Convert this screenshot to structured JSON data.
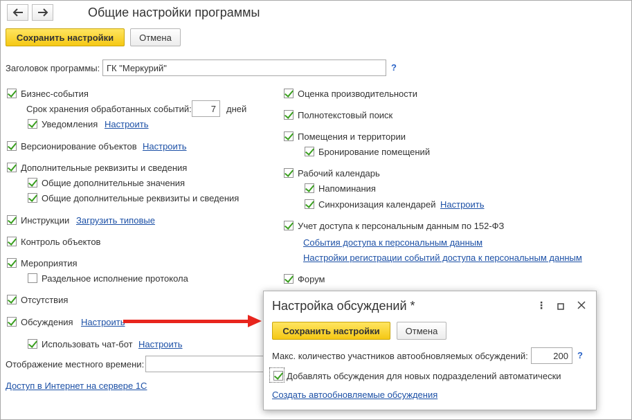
{
  "header": {
    "back_icon": "arrow-left-icon",
    "forward_icon": "arrow-right-icon",
    "title": "Общие настройки программы"
  },
  "toolbar": {
    "save_label": "Сохранить настройки",
    "cancel_label": "Отмена"
  },
  "program_title": {
    "label": "Заголовок программы:",
    "value": "ГК \"Меркурий\"",
    "help": "?"
  },
  "left": {
    "business_events": {
      "label": "Бизнес-события",
      "checked": true
    },
    "retention": {
      "label": "Срок хранения обработанных событий:",
      "value": "7",
      "unit": "дней"
    },
    "notifications": {
      "label": "Уведомления",
      "checked": true,
      "link": "Настроить"
    },
    "versioning": {
      "label": "Версионирование объектов",
      "checked": true,
      "link": "Настроить"
    },
    "extra_props": {
      "label": "Дополнительные реквизиты и сведения",
      "checked": true
    },
    "common_values": {
      "label": "Общие дополнительные значения",
      "checked": true
    },
    "common_props": {
      "label": "Общие дополнительные реквизиты и сведения",
      "checked": true
    },
    "instructions": {
      "label": "Инструкции",
      "checked": true,
      "link": "Загрузить типовые"
    },
    "object_control": {
      "label": "Контроль объектов",
      "checked": true
    },
    "events": {
      "label": "Мероприятия",
      "checked": true
    },
    "separate_protocol": {
      "label": "Раздельное исполнение протокола",
      "checked": false
    },
    "absences": {
      "label": "Отсутствия",
      "checked": true
    },
    "discussions": {
      "label": "Обсуждения",
      "checked": true,
      "link": "Настроить"
    },
    "chatbot": {
      "label": "Использовать чат-бот",
      "checked": true,
      "link": "Настроить"
    },
    "local_time": {
      "label": "Отображение местного времени:",
      "value": ""
    },
    "internet_access": {
      "link": "Доступ в Интернет на сервере 1С"
    }
  },
  "right": {
    "performance": {
      "label": "Оценка производительности",
      "checked": true
    },
    "fulltext": {
      "label": "Полнотекстовый поиск",
      "checked": true
    },
    "rooms": {
      "label": "Помещения и территории",
      "checked": true
    },
    "room_booking": {
      "label": "Бронирование помещений",
      "checked": true
    },
    "work_calendar": {
      "label": "Рабочий календарь",
      "checked": true
    },
    "reminders": {
      "label": "Напоминания",
      "checked": true
    },
    "calendar_sync": {
      "label": "Синхронизация календарей",
      "checked": true,
      "link": "Настроить"
    },
    "personal_data": {
      "label": "Учет доступа к персональным данным по 152-ФЗ",
      "checked": true
    },
    "pd_events_link": "События доступа к персональным данным",
    "pd_settings_link": "Настройки регистрации событий доступа к персональным данным",
    "forum": {
      "label": "Форум",
      "checked": true
    }
  },
  "dialog": {
    "title": "Настройка обсуждений *",
    "menu_icon": "more-vertical-icon",
    "maximize_icon": "maximize-icon",
    "close_icon": "close-icon",
    "save_label": "Сохранить настройки",
    "cancel_label": "Отмена",
    "max_participants_label": "Макс. количество участников автообновляемых обсуждений:",
    "max_participants_value": "200",
    "help": "?",
    "auto_add": {
      "label": "Добавлять обсуждения для новых подразделений автоматически",
      "checked": true
    },
    "create_link": "Создать автообновляемые обсуждения"
  },
  "colors": {
    "accent_button": "#f5c814",
    "link": "#1c50a6",
    "check": "#3a9f1f",
    "annotation_arrow": "#e8251d"
  }
}
